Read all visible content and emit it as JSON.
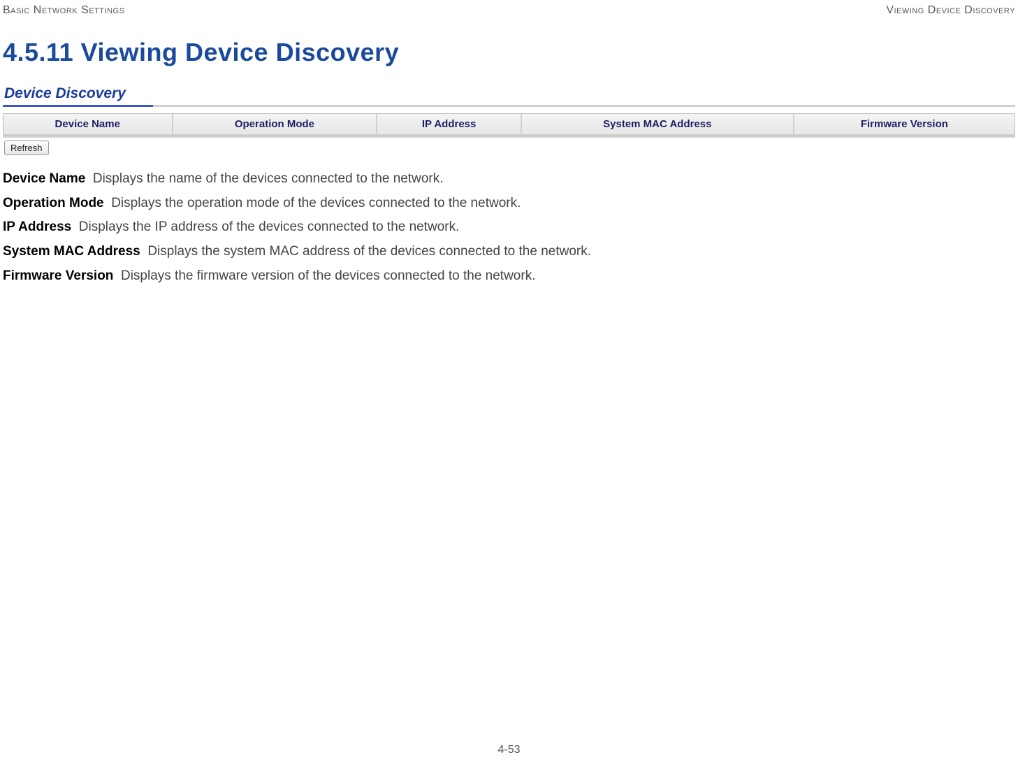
{
  "header": {
    "left": "Basic Network Settings",
    "right": "Viewing Device Discovery"
  },
  "heading": "4.5.11 Viewing Device Discovery",
  "panel": {
    "title": "Device Discovery",
    "columns": [
      "Device Name",
      "Operation Mode",
      "IP Address",
      "System MAC Address",
      "Firmware Version"
    ],
    "refresh_label": "Refresh"
  },
  "definitions": [
    {
      "term": "Device Name",
      "desc": "Displays the name of the devices connected to the network."
    },
    {
      "term": "Operation Mode",
      "desc": "Displays the operation mode of the devices connected to the network."
    },
    {
      "term": "IP Address",
      "desc": "Displays the IP address of the devices connected to the network."
    },
    {
      "term": "System MAC Address",
      "desc": "Displays the system MAC address of the devices connected to the network."
    },
    {
      "term": "Firmware Version",
      "desc": "Displays the firmware version of the devices connected to the network."
    }
  ],
  "page_number": "4-53"
}
